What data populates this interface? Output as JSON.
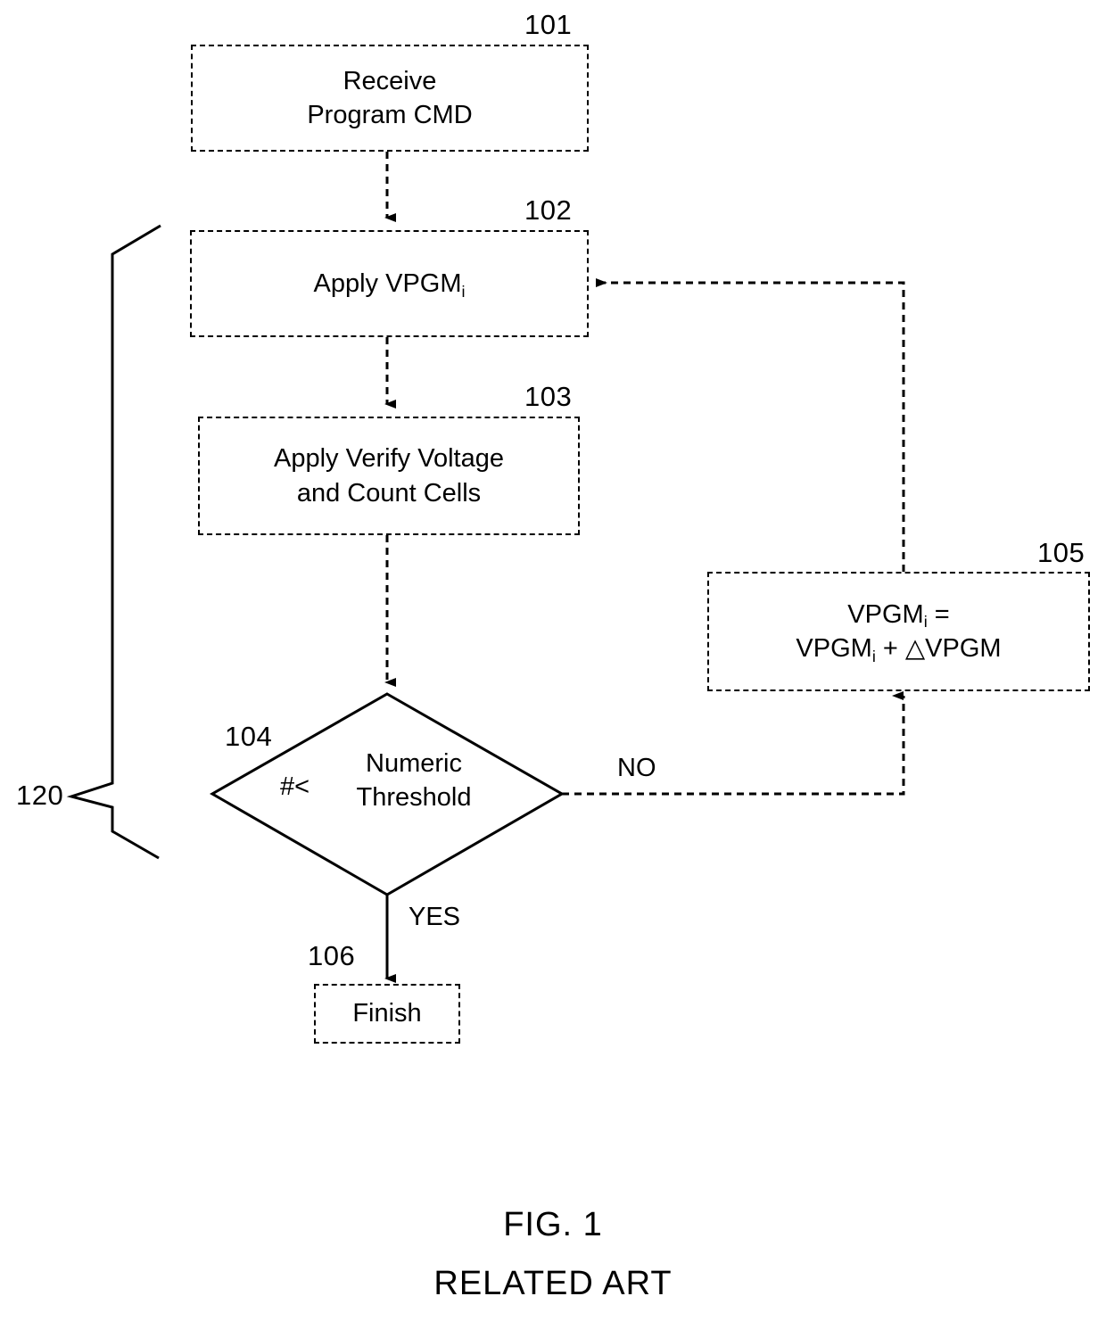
{
  "figure": {
    "caption_title": "FIG. 1",
    "caption_subtitle": "RELATED ART",
    "line_color": "#000000",
    "background": "#ffffff"
  },
  "nodes": {
    "receive_cmd": {
      "ref": "101",
      "line1": "Receive",
      "line2": "Program CMD"
    },
    "apply_vpgm": {
      "ref": "102",
      "text_prefix": "Apply VPGM",
      "text_subscript": "i"
    },
    "verify_count": {
      "ref": "103",
      "line1": "Apply Verify Voltage",
      "line2": "and Count Cells"
    },
    "decision": {
      "ref": "104",
      "operator": "#<",
      "line1": "Numeric",
      "line2": "Threshold"
    },
    "increment_vpgm": {
      "ref": "105",
      "line1_prefix": "VPGM",
      "line1_subscript": "i",
      "line1_suffix": " =",
      "line2_prefix": "VPGM",
      "line2_subscript": "i",
      "line2_suffix": " + △VPGM"
    },
    "finish": {
      "ref": "106",
      "label": "Finish"
    }
  },
  "edges": {
    "yes_label": "YES",
    "no_label": "NO"
  },
  "group_bracket": {
    "ref": "120"
  }
}
